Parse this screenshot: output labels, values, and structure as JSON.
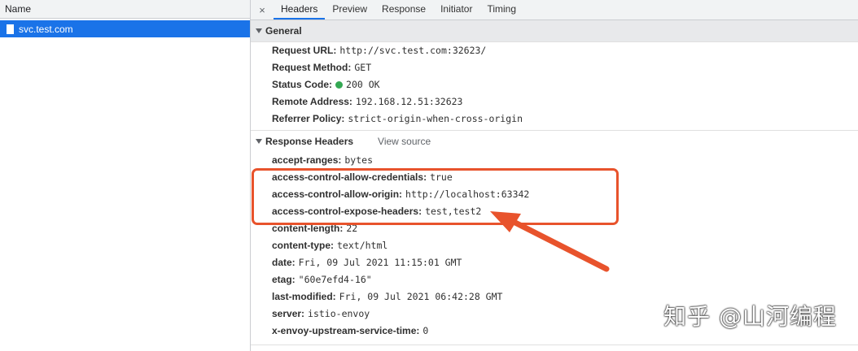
{
  "left_panel": {
    "column_header": "Name",
    "selected_request": "svc.test.com"
  },
  "tabs": {
    "close_symbol": "×",
    "items": [
      "Headers",
      "Preview",
      "Response",
      "Initiator",
      "Timing"
    ],
    "active": "Headers"
  },
  "general": {
    "title": "General",
    "rows": [
      {
        "key": "Request URL:",
        "value": "http://svc.test.com:32623/"
      },
      {
        "key": "Request Method:",
        "value": "GET"
      },
      {
        "key": "Status Code:",
        "value": "200 OK"
      },
      {
        "key": "Remote Address:",
        "value": "192.168.12.51:32623"
      },
      {
        "key": "Referrer Policy:",
        "value": "strict-origin-when-cross-origin"
      }
    ]
  },
  "response_headers": {
    "title": "Response Headers",
    "view_source": "View source",
    "rows": [
      {
        "key": "accept-ranges:",
        "value": "bytes"
      },
      {
        "key": "access-control-allow-credentials:",
        "value": "true"
      },
      {
        "key": "access-control-allow-origin:",
        "value": "http://localhost:63342"
      },
      {
        "key": "access-control-expose-headers:",
        "value": "test,test2"
      },
      {
        "key": "content-length:",
        "value": "22"
      },
      {
        "key": "content-type:",
        "value": "text/html"
      },
      {
        "key": "date:",
        "value": "Fri, 09 Jul 2021 11:15:01 GMT"
      },
      {
        "key": "etag:",
        "value": "\"60e7efd4-16\""
      },
      {
        "key": "last-modified:",
        "value": "Fri, 09 Jul 2021 06:42:28 GMT"
      },
      {
        "key": "server:",
        "value": "istio-envoy"
      },
      {
        "key": "x-envoy-upstream-service-time:",
        "value": "0"
      }
    ]
  },
  "colors": {
    "accent": "#1a73e8",
    "annotation": "#e8532c",
    "status_ok": "#34a853"
  },
  "watermark": "知乎 @山河编程"
}
